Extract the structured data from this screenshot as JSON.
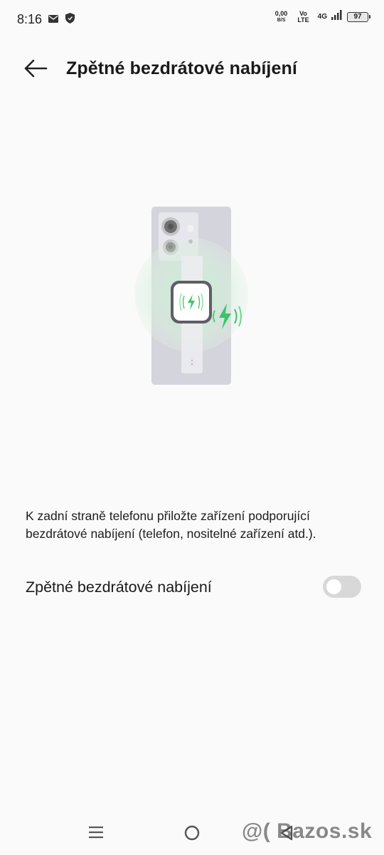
{
  "status_bar": {
    "time": "8:16",
    "net_speed_value": "0,00",
    "net_speed_unit": "B/S",
    "volte_top": "Vo",
    "volte_bottom": "LTE",
    "network_type": "4G",
    "battery_level": "97",
    "icons": [
      "mail-icon",
      "shield-icon",
      "signal-icon",
      "battery-icon"
    ]
  },
  "header": {
    "title": "Zpětné bezdrátové nabíjení",
    "back_icon": "arrow-left-icon"
  },
  "main": {
    "description": "K zadní straně telefonu přiložte zařízení podporující bezdrátové nabíjení (telefon, nositelné zařízení atd.).",
    "toggle": {
      "label": "Zpětné bezdrátové nabíjení",
      "state": "off"
    }
  },
  "nav_bar": {
    "icons": [
      "menu-icon",
      "home-icon",
      "back-icon"
    ],
    "watermark": "@( Bazos.sk"
  },
  "colors": {
    "accent_green": "#3cc46a",
    "toggle_off": "#d8d8d8",
    "background": "#fafafa"
  }
}
